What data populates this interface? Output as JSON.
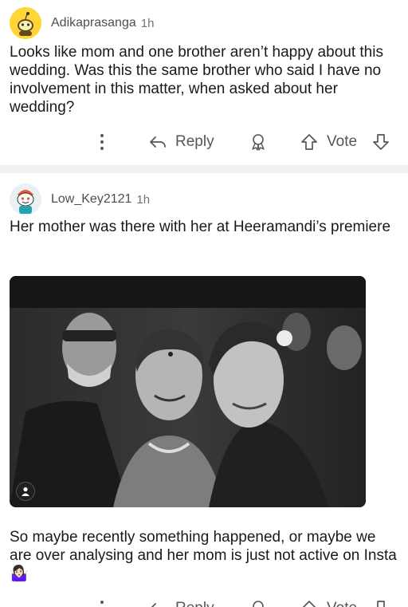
{
  "comments": [
    {
      "username": "Adikaprasanga",
      "time": "1h",
      "body": "Looks like mom and one brother aren’t happy about this wedding. Was this the same brother who said I have no involvement in this matter, when asked about her wedding?",
      "avatar_icon": "snoo-avatar-yellow-icon",
      "actions": {
        "reply": "Reply",
        "vote": "Vote"
      }
    },
    {
      "username": "Low_Key2121",
      "time": "1h",
      "body": "Her mother was there with her at Heeramandi’s premiere",
      "image_icon": "user-tag-icon",
      "body_after": "So maybe recently something happened, or maybe we are over analysing and her mom is just not active on Insta 🤷🏻‍♀️",
      "avatar_icon": "snoo-avatar-icon",
      "actions": {
        "reply": "Reply",
        "vote": "Vote"
      }
    }
  ],
  "colors": {
    "separator": "#eef0f2",
    "text": "#1a1a1b",
    "meta": "#6f7375",
    "avatar_yellow": "#ffd635"
  }
}
